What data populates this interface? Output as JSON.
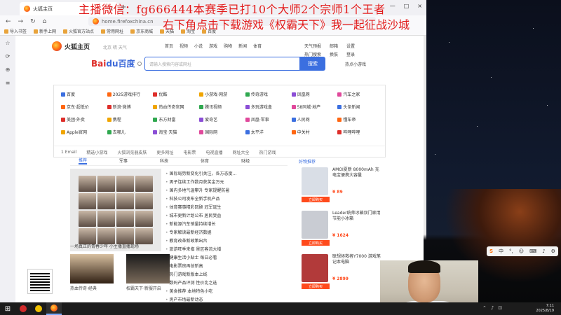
{
  "overlay": {
    "line1": "主播微信：fg666444本赛季已打10个大师2个宗师1个王者",
    "line2": "右下角点击下载游戏《权霸天下》我一起征战沙城"
  },
  "browser": {
    "tab_title": "火狐主页",
    "tab_close": "×",
    "new_tab": "+",
    "win_min": "—",
    "win_max": "□",
    "win_close": "×",
    "nav": {
      "back": "←",
      "forward": "→",
      "reload": "↻",
      "home": "⌂"
    },
    "url": "home.firefoxchina.cn",
    "bookmarks": [
      "导入书签",
      "新手上网",
      "火狐官方站点",
      "常用网址",
      "京东商城",
      "天猫",
      "淘宝",
      "百度"
    ],
    "sidebar": [
      "☆",
      "⟳",
      "⊕",
      "≡"
    ]
  },
  "page": {
    "logo_name": "火狐主页",
    "city": "北京 晴 天气",
    "topnav": [
      "首页",
      "视频",
      "小说",
      "游戏",
      "购物",
      "新闻",
      "体育"
    ],
    "hdr_right": [
      "天气预报",
      "邮箱",
      "设置"
    ],
    "hdr_right2": [
      "热门搜索",
      "换肤",
      "登录"
    ],
    "baidu_b1": "Bai",
    "baidu_b2": "du百度",
    "search_placeholder": "请输入搜索内容或网址",
    "search_button": "搜索",
    "search_right": "热点小游戏",
    "grid": [
      [
        "百度",
        "2025游戏排行",
        "优酷",
        "小游戏·网游",
        "传奇游戏",
        "凤凰网",
        "汽车之家"
      ],
      [
        "京东·超低价",
        "新浪·微博",
        "热血传奇官网",
        "腾讯视频",
        "多玩游戏盒",
        "58同城·地产",
        "头条新闻"
      ],
      [
        "美团·外卖",
        "携程",
        "东方财富",
        "爱奇艺",
        "凤凰·军事",
        "人民网",
        "懂车帝"
      ],
      [
        "Apple官网",
        "去哪儿",
        "淘宝·天猫",
        "国际网",
        "太平洋",
        "中关村",
        "哔哩哔哩"
      ]
    ],
    "grid_footer": [
      "1 Email",
      "精选小游戏",
      "火狐浏览器皮肤",
      "更多网址",
      "电影票",
      "电视直播",
      "网址大全",
      "热门游戏"
    ],
    "tabs": [
      "推荐",
      "军事",
      "科技",
      "体育",
      "财经"
    ],
    "photo_caption": "一场真正的青春少年 小主播直播现场",
    "photo2a_caption": "热血传奇·经典",
    "photo2b_caption": "权霸天下·新服开启",
    "news": [
      "国际局势新变化引关注，各方态度…",
      "男子连续工作数月获奖金万元",
      "国内多地气温攀升 专家提醒防暑",
      "科技公司发布全新手机产品",
      "体育赛事精彩回顾 冠军诞生",
      "城市更新计划公布 居民受益",
      "新能源汽车销量持续增长",
      "专家解读最新经济数据",
      "教育改革新政策出台",
      "旅游旺季来临 景区客流大增",
      "健康生活小贴士 每日必看",
      "电影票房再创新高",
      "热门游戏新版本上线",
      "数码产品评测 性价比之选",
      "美食推荐 本地特色小吃",
      "房产市场最新动态"
    ],
    "shop_header": "好物推荐",
    "shop": [
      {
        "title": "AMOI夏新 8000mAh 充电宝便携大容量",
        "price": "¥ 89",
        "btn": "立即购买",
        "color": "#d9dee6"
      },
      {
        "title": "Leader统帅冰箱双门家用节能小冰箱",
        "price": "¥ 1624",
        "btn": "立即购买",
        "color": "#c9ccd3"
      },
      {
        "title": "联想拯救者Y7000 游戏笔记本电脑",
        "price": "¥ 2899",
        "btn": "立即购买",
        "color": "#b23a3a"
      }
    ]
  },
  "desktop": {
    "ime": [
      "S",
      "中",
      "°,",
      "☺",
      "⌨",
      "♪",
      "⚙"
    ],
    "tray": [
      "⌃",
      "♪",
      "⊡"
    ],
    "clock_time": "7:11",
    "clock_date": "2025/8/19"
  }
}
